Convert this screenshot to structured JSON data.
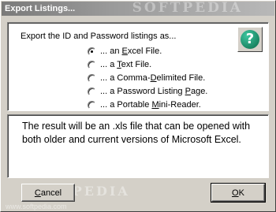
{
  "window": {
    "title": "Export Listings...",
    "watermark": "SOFTPEDIA"
  },
  "prompt": "Export the ID and Password listings as...",
  "help_button": {
    "icon": "question-mark-icon",
    "label": "?"
  },
  "options": [
    {
      "pre": "... an ",
      "key": "E",
      "post": "xcel File.",
      "selected": true
    },
    {
      "pre": "... a ",
      "key": "T",
      "post": "ext File.",
      "selected": false
    },
    {
      "pre": "... a Comma-",
      "key": "D",
      "post": "elimited File.",
      "selected": false
    },
    {
      "pre": "... a Password Listing ",
      "key": "P",
      "post": "age.",
      "selected": false
    },
    {
      "pre": "... a Portable ",
      "key": "M",
      "post": "ini-Reader.",
      "selected": false
    }
  ],
  "description": "The result will be an .xls file that can be opened with both older and current versions of Microsoft Excel.",
  "buttons": {
    "cancel": {
      "key": "C",
      "rest": "ancel"
    },
    "ok": {
      "key": "O",
      "rest": "K"
    }
  },
  "footer_watermark": "www.softpedia.com",
  "footer_watermark_logo": "SOFTPEDIA"
}
